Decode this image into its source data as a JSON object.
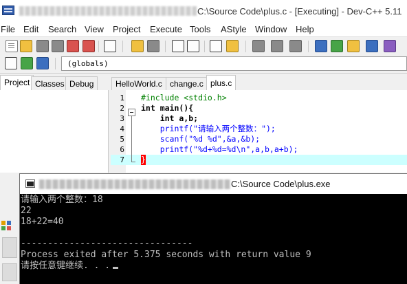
{
  "window": {
    "title_suffix": "C:\\Source Code\\plus.c - [Executing] - Dev-C++ 5.11"
  },
  "menu": [
    "File",
    "Edit",
    "Search",
    "View",
    "Project",
    "Execute",
    "Tools",
    "AStyle",
    "Window",
    "Help"
  ],
  "toolbar": {
    "scope_select": "(globals)"
  },
  "left_panel": {
    "tabs": [
      "Project",
      "Classes",
      "Debug"
    ],
    "active_tab": "Project"
  },
  "editor": {
    "tabs": [
      "HelloWorld.c",
      "change.c",
      "plus.c"
    ],
    "active_tab": "plus.c",
    "line_numbers": [
      "1",
      "2",
      "3",
      "4",
      "5",
      "6",
      "7"
    ],
    "lines": [
      "#include <stdio.h>",
      "int main(){",
      "    int a,b;",
      "    printf(\"请输入两个整数：\");",
      "    scanf(\"%d %d\",&a,&b);",
      "    printf(\"%d+%d=%d\\n\",a,b,a+b);",
      "}"
    ]
  },
  "console": {
    "title_suffix": "C:\\Source Code\\plus.exe",
    "lines": [
      "请输入两个整数：18",
      "22",
      "18+22=40",
      "",
      "--------------------------------",
      "Process exited after 5.375 seconds with return value 9",
      "请按任意键继续. . ."
    ]
  },
  "colors": {
    "preprocessor": "#008000",
    "string": "#0000ff",
    "symbol": "#ff0000",
    "current_line": "#ccffff",
    "console_bg": "#000000",
    "console_fg": "#c0c0c0"
  }
}
